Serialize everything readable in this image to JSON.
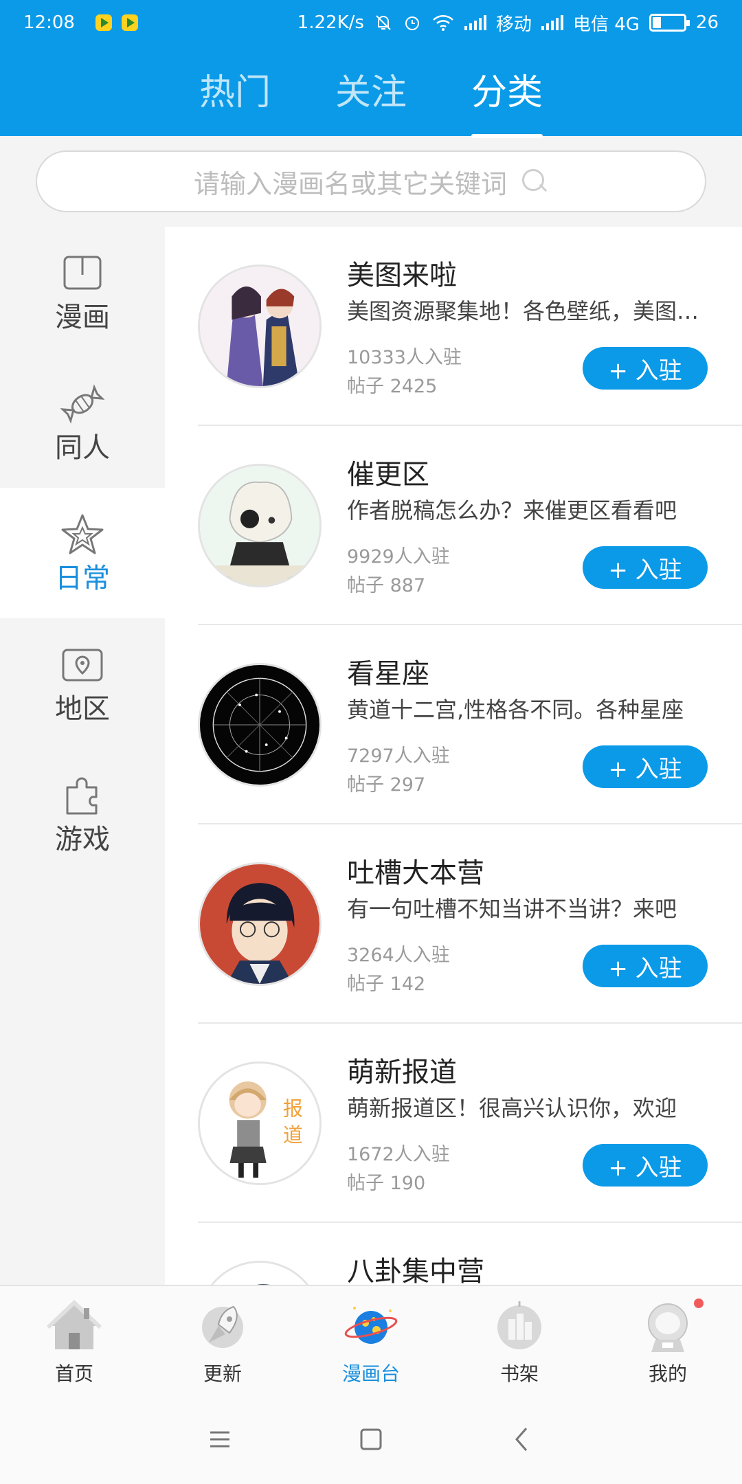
{
  "status": {
    "time": "12:08",
    "speed": "1.22K/s",
    "carrier1": "移动",
    "carrier2": "电信 4G",
    "battery": "26"
  },
  "tabs": [
    {
      "label": "热门"
    },
    {
      "label": "关注"
    },
    {
      "label": "分类"
    }
  ],
  "search": {
    "placeholder": "请输入漫画名或其它关键词"
  },
  "categories": [
    {
      "label": "漫画",
      "icon": "book-icon"
    },
    {
      "label": "同人",
      "icon": "candy-icon"
    },
    {
      "label": "日常",
      "icon": "star-icon"
    },
    {
      "label": "地区",
      "icon": "location-icon"
    },
    {
      "label": "游戏",
      "icon": "puzzle-icon"
    }
  ],
  "items": [
    {
      "title": "美图来啦",
      "desc": "美图资源聚集地！各色壁纸，美图资源聚集",
      "members": "10333人入驻",
      "posts": "帖子 2425",
      "join": "+ 入驻"
    },
    {
      "title": "催更区",
      "desc": "作者脱稿怎么办？来催更区看看吧",
      "members": "9929人入驻",
      "posts": "帖子 887",
      "join": "+ 入驻"
    },
    {
      "title": "看星座",
      "desc": "黄道十二宫,性格各不同。各种星座",
      "members": "7297人入驻",
      "posts": "帖子 297",
      "join": "+ 入驻"
    },
    {
      "title": "吐槽大本营",
      "desc": "有一句吐槽不知当讲不当讲？来吧",
      "members": "3264人入驻",
      "posts": "帖子 142",
      "join": "+ 入驻"
    },
    {
      "title": "萌新报道",
      "desc": "萌新报道区！很高兴认识你，欢迎",
      "members": "1672人入驻",
      "posts": "帖子 190",
      "join": "+ 入驻"
    },
    {
      "title": "八卦集中营"
    }
  ],
  "avatar_badge": "报道",
  "bottom_nav": [
    {
      "label": "首页",
      "icon": "home-icon"
    },
    {
      "label": "更新",
      "icon": "rocket-icon"
    },
    {
      "label": "漫画台",
      "icon": "planet-icon"
    },
    {
      "label": "书架",
      "icon": "bookshelf-icon"
    },
    {
      "label": "我的",
      "icon": "astronaut-icon"
    }
  ],
  "colors": {
    "primary": "#0a9ae8",
    "active_text": "#1a8fdd"
  }
}
